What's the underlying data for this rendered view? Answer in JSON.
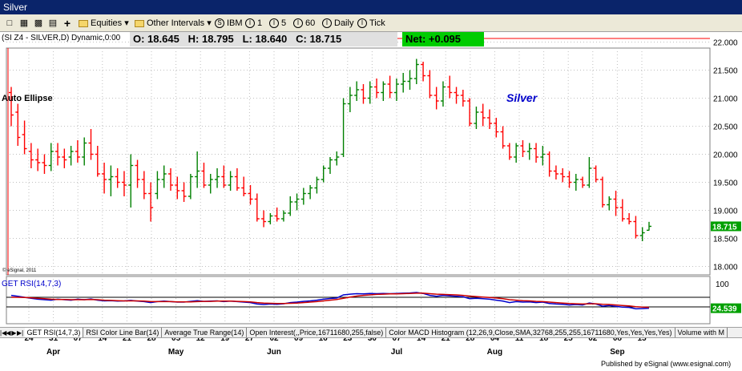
{
  "window": {
    "title": "Silver"
  },
  "toolbar": {
    "equities_label": "Equities",
    "other_intervals_label": "Other Intervals",
    "symbol_label": "IBM",
    "interval_1": "1",
    "interval_5": "5",
    "interval_60": "60",
    "daily_label": "Daily",
    "tick_label": "Tick",
    "add_icon": "plus-icon"
  },
  "header": {
    "symbol_line": "(SI Z4 - SILVER,D) Dynamic,0:00",
    "open": "O: 18.645",
    "high": "H: 18.795",
    "low": "L: 18.640",
    "close": "C: 18.715",
    "net": "Net: +0.095"
  },
  "annotations": {
    "auto_ellipse": "Auto Ellipse",
    "silver": "Silver",
    "copyright": "© eSignal, 2011",
    "rsi_label": "GET RSI(14,7,3)"
  },
  "price_axis": {
    "ticks": [
      "22.000",
      "21.500",
      "21.000",
      "20.500",
      "20.000",
      "19.500",
      "19.000",
      "18.500",
      "18.000"
    ],
    "current": "18.715"
  },
  "rsi_axis": {
    "top": "100",
    "current": "24.539"
  },
  "date_axis": {
    "days": [
      "24",
      "31",
      "07",
      "14",
      "21",
      "28",
      "05",
      "12",
      "19",
      "27",
      "02",
      "09",
      "16",
      "23",
      "30",
      "07",
      "14",
      "21",
      "28",
      "04",
      "11",
      "18",
      "25",
      "02",
      "08",
      "15"
    ],
    "months": [
      "Apr",
      "May",
      "Jun",
      "Jul",
      "Aug",
      "Sep"
    ]
  },
  "tabs": [
    "GET RSI(14,7,3)",
    "RSI Color Line Bar(14)",
    "Average True Range(14)",
    "Open Interest(,,Price,16711680,255,false)",
    "Color MACD Histogram (12,26,9,Close,SMA,32768,255,255,16711680,Yes,Yes,Yes,Yes)",
    "Volume with M"
  ],
  "footer": "Published by eSignal (www.esignal.com)",
  "colors": {
    "up": "#008000",
    "down": "#ff0000",
    "net_bg": "#00cc00",
    "title_bg": "#0a246a",
    "silver_text": "#0000cc"
  },
  "chart_data": {
    "type": "ohlc",
    "title": "Silver",
    "ylim": [
      17.85,
      22.15
    ],
    "bars": [
      [
        21.1,
        21.2,
        20.5,
        20.7
      ],
      [
        20.75,
        20.9,
        20.15,
        20.3
      ],
      [
        20.35,
        20.6,
        20.0,
        20.1
      ],
      [
        20.05,
        20.2,
        19.75,
        19.9
      ],
      [
        19.9,
        20.1,
        19.7,
        19.85
      ],
      [
        19.85,
        20.0,
        19.65,
        19.8
      ],
      [
        19.8,
        20.2,
        19.7,
        20.05
      ],
      [
        20.05,
        20.2,
        19.8,
        19.95
      ],
      [
        19.95,
        20.1,
        19.75,
        19.9
      ],
      [
        19.95,
        20.15,
        19.8,
        20.05
      ],
      [
        20.05,
        20.25,
        19.85,
        19.95
      ],
      [
        19.95,
        20.3,
        19.8,
        20.2
      ],
      [
        20.2,
        20.45,
        19.9,
        20.0
      ],
      [
        20.0,
        20.15,
        19.6,
        19.65
      ],
      [
        19.65,
        19.85,
        19.3,
        19.55
      ],
      [
        19.55,
        19.8,
        19.25,
        19.6
      ],
      [
        19.6,
        19.75,
        19.4,
        19.5
      ],
      [
        19.5,
        19.7,
        19.25,
        19.45
      ],
      [
        19.45,
        20.0,
        19.05,
        19.8
      ],
      [
        19.8,
        19.9,
        19.4,
        19.55
      ],
      [
        19.55,
        19.7,
        19.2,
        19.3
      ],
      [
        19.3,
        19.5,
        18.8,
        19.05
      ],
      [
        19.3,
        19.7,
        19.2,
        19.55
      ],
      [
        19.55,
        19.8,
        19.4,
        19.65
      ],
      [
        19.65,
        19.75,
        19.35,
        19.45
      ],
      [
        19.45,
        19.6,
        19.2,
        19.35
      ],
      [
        19.35,
        19.5,
        19.15,
        19.25
      ],
      [
        19.25,
        19.65,
        19.2,
        19.6
      ],
      [
        19.6,
        20.05,
        19.4,
        19.7
      ],
      [
        19.7,
        19.85,
        19.4,
        19.45
      ],
      [
        19.45,
        19.65,
        19.3,
        19.55
      ],
      [
        19.55,
        19.75,
        19.4,
        19.6
      ],
      [
        19.6,
        19.8,
        19.4,
        19.45
      ],
      [
        19.45,
        19.7,
        19.35,
        19.6
      ],
      [
        19.6,
        19.75,
        19.35,
        19.4
      ],
      [
        19.4,
        19.6,
        19.25,
        19.3
      ],
      [
        19.3,
        19.45,
        19.1,
        19.2
      ],
      [
        19.2,
        19.3,
        18.8,
        18.85
      ],
      [
        18.85,
        19.0,
        18.7,
        18.8
      ],
      [
        18.8,
        18.95,
        18.75,
        18.9
      ],
      [
        18.9,
        19.05,
        18.8,
        18.85
      ],
      [
        18.85,
        19.0,
        18.8,
        18.95
      ],
      [
        18.95,
        19.25,
        18.9,
        19.15
      ],
      [
        19.15,
        19.3,
        19.0,
        19.2
      ],
      [
        19.2,
        19.4,
        19.1,
        19.3
      ],
      [
        19.3,
        19.45,
        19.2,
        19.4
      ],
      [
        19.4,
        19.6,
        19.3,
        19.55
      ],
      [
        19.55,
        19.8,
        19.5,
        19.75
      ],
      [
        19.75,
        19.95,
        19.65,
        19.9
      ],
      [
        19.9,
        20.05,
        19.8,
        19.95
      ],
      [
        20.0,
        21.0,
        19.95,
        20.9
      ],
      [
        20.9,
        21.2,
        20.75,
        21.05
      ],
      [
        21.05,
        21.3,
        20.95,
        21.15
      ],
      [
        21.15,
        21.25,
        20.9,
        21.0
      ],
      [
        21.0,
        21.3,
        20.9,
        21.2
      ],
      [
        21.2,
        21.35,
        21.0,
        21.1
      ],
      [
        21.1,
        21.3,
        20.95,
        21.25
      ],
      [
        21.25,
        21.4,
        21.0,
        21.1
      ],
      [
        21.1,
        21.35,
        20.95,
        21.25
      ],
      [
        21.25,
        21.45,
        21.1,
        21.3
      ],
      [
        21.3,
        21.5,
        21.15,
        21.35
      ],
      [
        21.35,
        21.7,
        21.25,
        21.6
      ],
      [
        21.6,
        21.65,
        21.3,
        21.4
      ],
      [
        21.4,
        21.5,
        21.0,
        21.05
      ],
      [
        21.05,
        21.2,
        20.8,
        20.95
      ],
      [
        20.95,
        21.3,
        20.85,
        21.2
      ],
      [
        21.2,
        21.4,
        21.0,
        21.1
      ],
      [
        21.1,
        21.2,
        20.9,
        21.05
      ],
      [
        21.05,
        21.15,
        20.85,
        20.95
      ],
      [
        20.95,
        21.0,
        20.5,
        20.55
      ],
      [
        20.55,
        20.85,
        20.45,
        20.75
      ],
      [
        20.75,
        20.9,
        20.5,
        20.65
      ],
      [
        20.65,
        20.8,
        20.45,
        20.55
      ],
      [
        20.55,
        20.65,
        20.3,
        20.4
      ],
      [
        20.4,
        20.5,
        20.1,
        20.15
      ],
      [
        20.15,
        20.2,
        19.9,
        19.95
      ],
      [
        19.95,
        20.2,
        19.85,
        20.15
      ],
      [
        20.15,
        20.25,
        19.95,
        20.05
      ],
      [
        20.05,
        20.2,
        19.9,
        20.1
      ],
      [
        20.1,
        20.2,
        19.85,
        19.95
      ],
      [
        19.95,
        20.15,
        19.8,
        20.0
      ],
      [
        20.0,
        20.05,
        19.6,
        19.7
      ],
      [
        19.7,
        19.8,
        19.55,
        19.65
      ],
      [
        19.65,
        19.75,
        19.5,
        19.6
      ],
      [
        19.6,
        19.7,
        19.4,
        19.5
      ],
      [
        19.5,
        19.65,
        19.35,
        19.55
      ],
      [
        19.55,
        19.6,
        19.4,
        19.45
      ],
      [
        19.45,
        19.95,
        19.4,
        19.75
      ],
      [
        19.75,
        19.8,
        19.5,
        19.55
      ],
      [
        19.55,
        19.6,
        19.05,
        19.1
      ],
      [
        19.1,
        19.25,
        19.0,
        19.2
      ],
      [
        19.2,
        19.35,
        18.9,
        19.05
      ],
      [
        19.05,
        19.2,
        18.8,
        18.85
      ],
      [
        18.85,
        18.95,
        18.75,
        18.8
      ],
      [
        18.8,
        18.9,
        18.5,
        18.55
      ],
      [
        18.55,
        18.7,
        18.45,
        18.6
      ],
      [
        18.645,
        18.795,
        18.64,
        18.715
      ]
    ],
    "rsi": [
      78,
      74,
      70,
      66,
      62,
      60,
      58,
      62,
      60,
      58,
      62,
      60,
      63,
      58,
      55,
      56,
      54,
      55,
      57,
      54,
      52,
      48,
      52,
      54,
      52,
      50,
      50,
      53,
      56,
      53,
      54,
      55,
      52,
      54,
      52,
      50,
      48,
      42,
      40,
      42,
      41,
      43,
      48,
      50,
      53,
      55,
      58,
      62,
      65,
      67,
      80,
      83,
      85,
      84,
      86,
      85,
      86,
      85,
      86,
      87,
      88,
      90,
      86,
      78,
      74,
      78,
      76,
      74,
      72,
      64,
      66,
      64,
      62,
      58,
      54,
      48,
      52,
      50,
      51,
      48,
      50,
      44,
      42,
      41,
      38,
      40,
      38,
      46,
      42,
      33,
      36,
      32,
      29,
      28,
      22,
      23,
      24.539
    ],
    "rsi_signal": [
      70,
      70,
      69,
      68,
      66,
      64,
      62,
      61,
      61,
      60,
      60,
      60,
      61,
      60,
      58,
      57,
      56,
      55,
      55,
      55,
      54,
      52,
      52,
      52,
      52,
      51,
      51,
      51,
      52,
      53,
      53,
      54,
      54,
      54,
      53,
      52,
      51,
      48,
      46,
      45,
      44,
      44,
      45,
      46,
      48,
      50,
      52,
      55,
      58,
      61,
      66,
      71,
      75,
      78,
      80,
      82,
      83,
      84,
      84,
      85,
      86,
      87,
      87,
      85,
      83,
      82,
      81,
      80,
      78,
      75,
      73,
      71,
      69,
      67,
      64,
      60,
      58,
      56,
      55,
      53,
      52,
      50,
      48,
      46,
      44,
      43,
      42,
      43,
      43,
      41,
      40,
      38,
      36,
      34,
      31,
      29,
      28
    ]
  }
}
